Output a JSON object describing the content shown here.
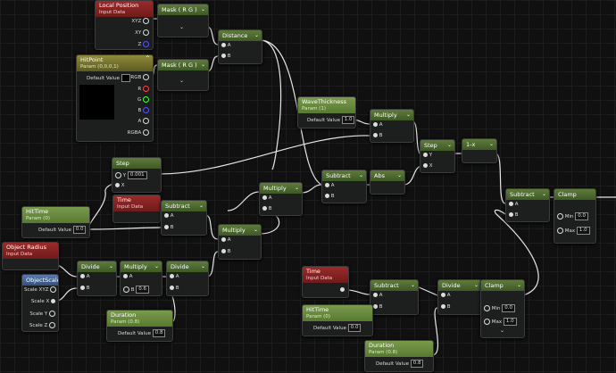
{
  "nodes": {
    "local_position": {
      "title": "Local Position",
      "subtitle": "Input Data",
      "pins": [
        "XYZ",
        "XY",
        "Z"
      ]
    },
    "mask1": {
      "title": "Mask ( R G )"
    },
    "distance": {
      "title": "Distance"
    },
    "hitpoint": {
      "title": "HitPoint",
      "subtitle": "Param (0,0,0,1)",
      "default_label": "Default Value",
      "pins": [
        "RGB",
        "R",
        "G",
        "B",
        "A",
        "RGBA"
      ]
    },
    "mask2": {
      "title": "Mask ( R G )"
    },
    "wave_thickness": {
      "title": "WaveThickness",
      "subtitle": "Param (1)",
      "default_label": "Default Value",
      "default_value": "1.0"
    },
    "multiply1": {
      "title": "Multiply"
    },
    "step1": {
      "title": "Step"
    },
    "one_minus": {
      "title": "1-x"
    },
    "step2": {
      "title": "Step",
      "y_value": "0.001"
    },
    "subtract1": {
      "title": "Subtract"
    },
    "abs": {
      "title": "Abs"
    },
    "subtract2": {
      "title": "Subtract"
    },
    "clamp1": {
      "title": "Clamp",
      "min_label": "Min",
      "min_value": "0.0",
      "max_label": "Max",
      "max_value": "1.0"
    },
    "multiply2": {
      "title": "Multiply"
    },
    "hittime1": {
      "title": "HitTime",
      "subtitle": "Param (0)",
      "default_label": "Default Value",
      "default_value": "0.0"
    },
    "time1": {
      "title": "Time",
      "subtitle": "Input Data"
    },
    "subtract3": {
      "title": "Subtract"
    },
    "multiply3": {
      "title": "Multiply"
    },
    "object_radius": {
      "title": "Object Radius",
      "subtitle": "Input Data"
    },
    "divide1": {
      "title": "Divide"
    },
    "multiply4": {
      "title": "Multiply",
      "b_value": "0.6"
    },
    "divide2": {
      "title": "Divide"
    },
    "object_scale": {
      "title": "ObjectScale",
      "pins": [
        "Scale XYZ",
        "Scale X",
        "Scale Y",
        "Scale Z"
      ]
    },
    "duration1": {
      "title": "Duration",
      "subtitle": "Param (0.8)",
      "default_label": "Default Value",
      "default_value": "0.8"
    },
    "time2": {
      "title": "Time",
      "subtitle": "Input Data"
    },
    "subtract4": {
      "title": "Subtract"
    },
    "divide3": {
      "title": "Divide"
    },
    "clamp2": {
      "title": "Clamp",
      "min_label": "Min",
      "min_value": "0.0",
      "max_label": "Max",
      "max_value": "1.0"
    },
    "hittime2": {
      "title": "HitTime",
      "subtitle": "Param (0)",
      "default_label": "Default Value",
      "default_value": "0.0"
    },
    "duration2": {
      "title": "Duration",
      "subtitle": "Param (0.8)",
      "default_label": "Default Value",
      "default_value": "0.8"
    }
  },
  "pin_labels": {
    "a": "A",
    "b": "B",
    "x": "X",
    "y": "Y"
  },
  "colors": {
    "param_green": "#5e7a3b",
    "input_red": "#9b2a2a",
    "vector_param_yellow": "#8f8a3a",
    "object_blue": "#5a7ab0",
    "wire": "#e6e6e6"
  }
}
